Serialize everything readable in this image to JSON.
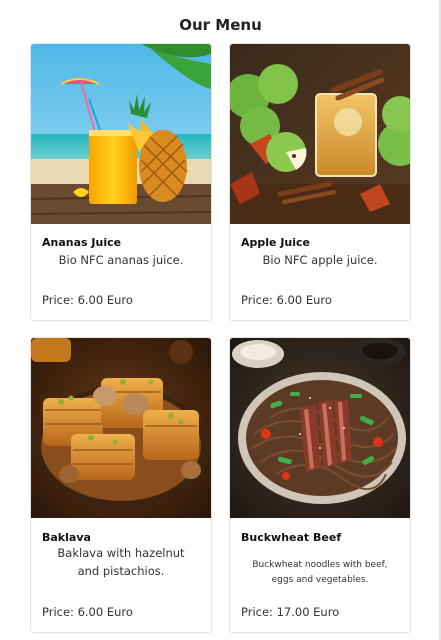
{
  "page": {
    "title": "Our Menu"
  },
  "menu_items": [
    {
      "name": "Ananas Juice",
      "description": "Bio NFC ananas juice.",
      "price": "Price: 6.00 Euro",
      "image": "pineapple-juice-image"
    },
    {
      "name": "Apple Juice",
      "description": "Bio NFC apple juice.",
      "price": "Price: 6.00 Euro",
      "image": "apple-juice-image"
    },
    {
      "name": "Baklava",
      "description": "Baklava with hazelnut and pistachios.",
      "price": "Price: 6.00 Euro",
      "image": "baklava-image"
    },
    {
      "name": "Buckwheat Beef",
      "description": "Buckwheat noodles with beef, eggs and vegetables.",
      "price": "Price: 17.00 Euro",
      "image": "buckwheat-beef-image"
    }
  ]
}
